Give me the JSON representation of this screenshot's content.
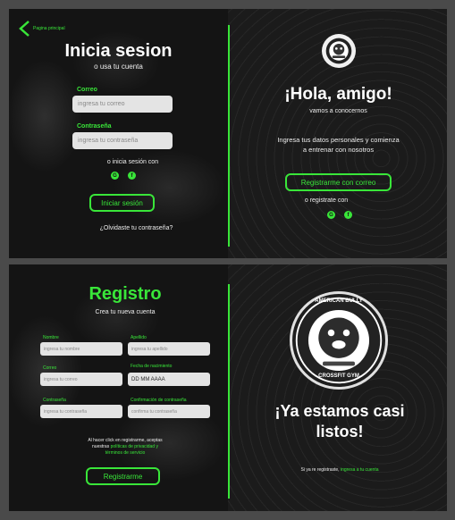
{
  "login": {
    "back_label": "Pagina principal",
    "title": "Inicia sesion",
    "subtitle": "o usa tu cuenta",
    "email_label": "Correo",
    "email_placeholder": "ingresa tu correo",
    "password_label": "Contraseña",
    "password_placeholder": "ingresa tu contraseña",
    "alt_login_text": "o inicia sesión con",
    "submit_label": "Iniciar sesión",
    "forgot_label": "¿Olvidaste tu contraseña?",
    "right": {
      "greeting": "¡Hola, amigo!",
      "greeting_sub": "vamos a conocernos",
      "description_line1": "Ingresa tus datos personales y comienza",
      "description_line2": "a entrenar con nosotros",
      "register_button": "Registrarme con correo",
      "alt_register_text": "o registrate con"
    }
  },
  "register": {
    "title": "Registro",
    "subtitle": "Crea tu nueva cuenta",
    "fields": {
      "name_label": "Nombre",
      "name_placeholder": "ingresa tu nombre",
      "lastname_label": "Apellido",
      "lastname_placeholder": "ingresa tu apellido",
      "email_label": "Correo",
      "email_placeholder": "ingresa tu correo",
      "birth_label": "Fecha de nacimiento",
      "birth_value": "DD  MM AAAA",
      "password_label": "Contraseña",
      "password_placeholder": "ingresa tu contraseña",
      "confirm_label": "Confirmación de contraseña",
      "confirm_placeholder": "confirma tu contraseña"
    },
    "terms_line1": "Al hacer click en registrarme, aceptas",
    "terms_line2_prefix": "nuestras ",
    "terms_link1": "políticas de privacidad y",
    "terms_link2": "términos de servicio",
    "submit_label": "Registrarme",
    "right": {
      "headline_line1": "¡Ya estamos casi",
      "headline_line2": "listos!",
      "registered_prefix": "Si ya re registraste, ",
      "login_link": "ingresa a tu cuenta"
    },
    "logo_top_text": "AMERICAN BULLY",
    "logo_bottom_text": "CROSSFIT GYM"
  },
  "colors": {
    "accent": "#39e639",
    "panel_bg": "#171717",
    "page_bg": "#4a4a4a"
  }
}
